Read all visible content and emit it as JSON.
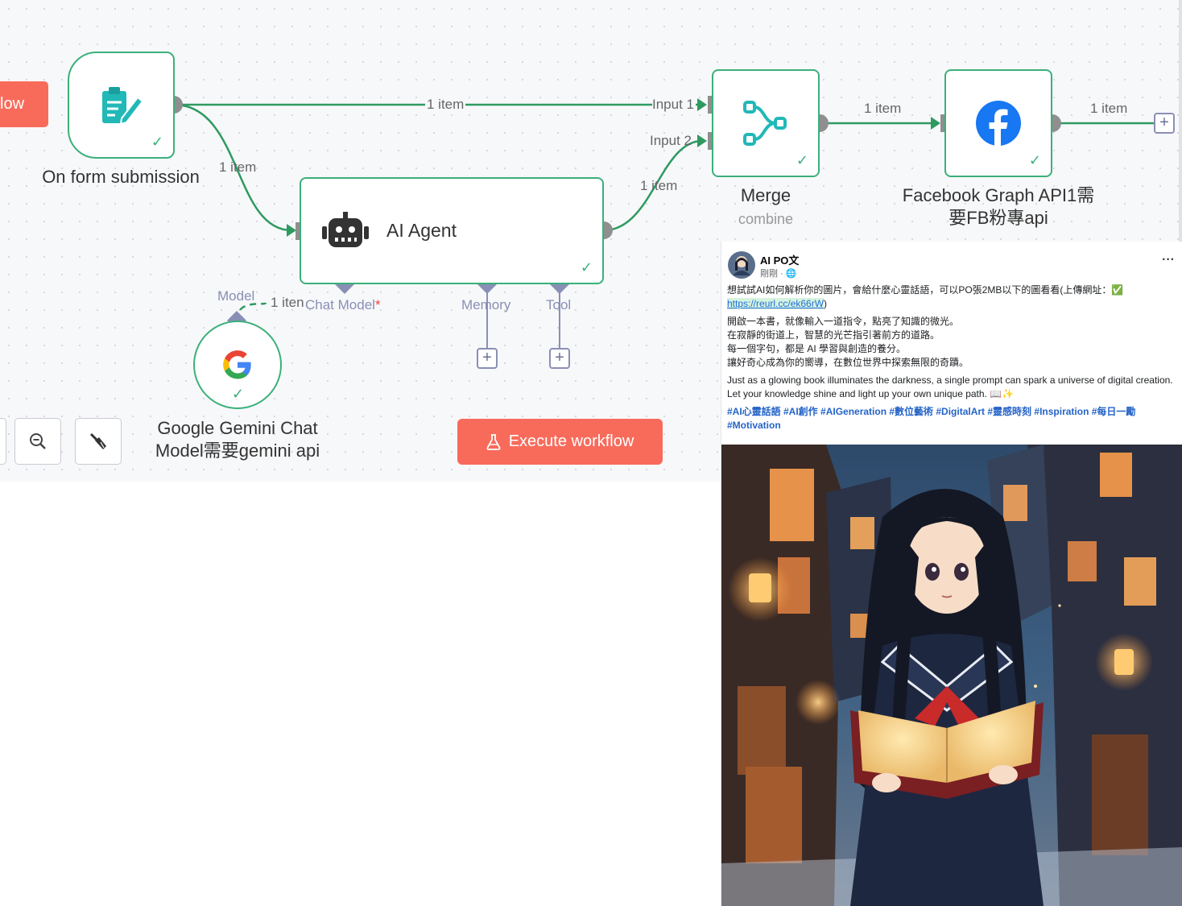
{
  "canvas": {
    "trigger_tab_label": "low",
    "nodes": {
      "form": {
        "label": "On form submission",
        "icon": "form-pencil-icon"
      },
      "agent": {
        "label": "AI Agent",
        "icon": "robot-icon"
      },
      "merge": {
        "label": "Merge",
        "sublabel": "combine",
        "icon": "merge-icon"
      },
      "facebook": {
        "label_line1": "Facebook Graph API1需",
        "label_line2": "要FB粉專api",
        "icon": "facebook-icon"
      },
      "gemini": {
        "label_line1": "Google Gemini Chat",
        "label_line2": "Model需要gemini api",
        "icon": "google-g-icon"
      }
    },
    "edge_labels": {
      "form_to_merge": "1 item",
      "form_to_agent": "1 item",
      "agent_to_merge": "1 item",
      "merge_to_fb": "1 item",
      "fb_out": "1 item",
      "gemini_to_agent": "1 iten"
    },
    "ports": {
      "input1": "Input 1",
      "input2": "Input 2",
      "chat_model": "Chat Model",
      "required_mark": "*",
      "memory": "Memory",
      "tool": "Tool",
      "model": "Model"
    },
    "execute_label": "Execute workflow",
    "colors": {
      "accent": "#f86b5b",
      "success": "#3bb07a",
      "port": "#8a8fb5",
      "edge": "#2e9a60"
    }
  },
  "post": {
    "author": "AI PO文",
    "meta": "剛剛 · ",
    "line1": "想試試AI如何解析你的圖片，會給什麼心靈話語，可以PO張2MB以下的圖看看(上傳網址：",
    "link": "https://reurl.cc/ek66rW",
    "link_close": ")",
    "cn_lines": [
      "開啟一本書，就像輸入一道指令，點亮了知識的微光。",
      "在寂靜的街道上，智慧的光芒指引著前方的道路。",
      "每一個字句，都是 AI 學習與創造的養分。",
      "讓好奇心成為你的嚮導，在數位世界中探索無限的奇蹟。"
    ],
    "en_text": "Just as a glowing book illuminates the darkness, a single prompt can spark a universe of digital creation. Let your knowledge shine and light up your own unique path. 📖✨",
    "hashtags": "#AI心靈話語 #AI創作 #AIGeneration #數位藝術 #DigitalArt #靈感時刻 #Inspiration #每日一勵 #Motivation",
    "more": "···"
  }
}
